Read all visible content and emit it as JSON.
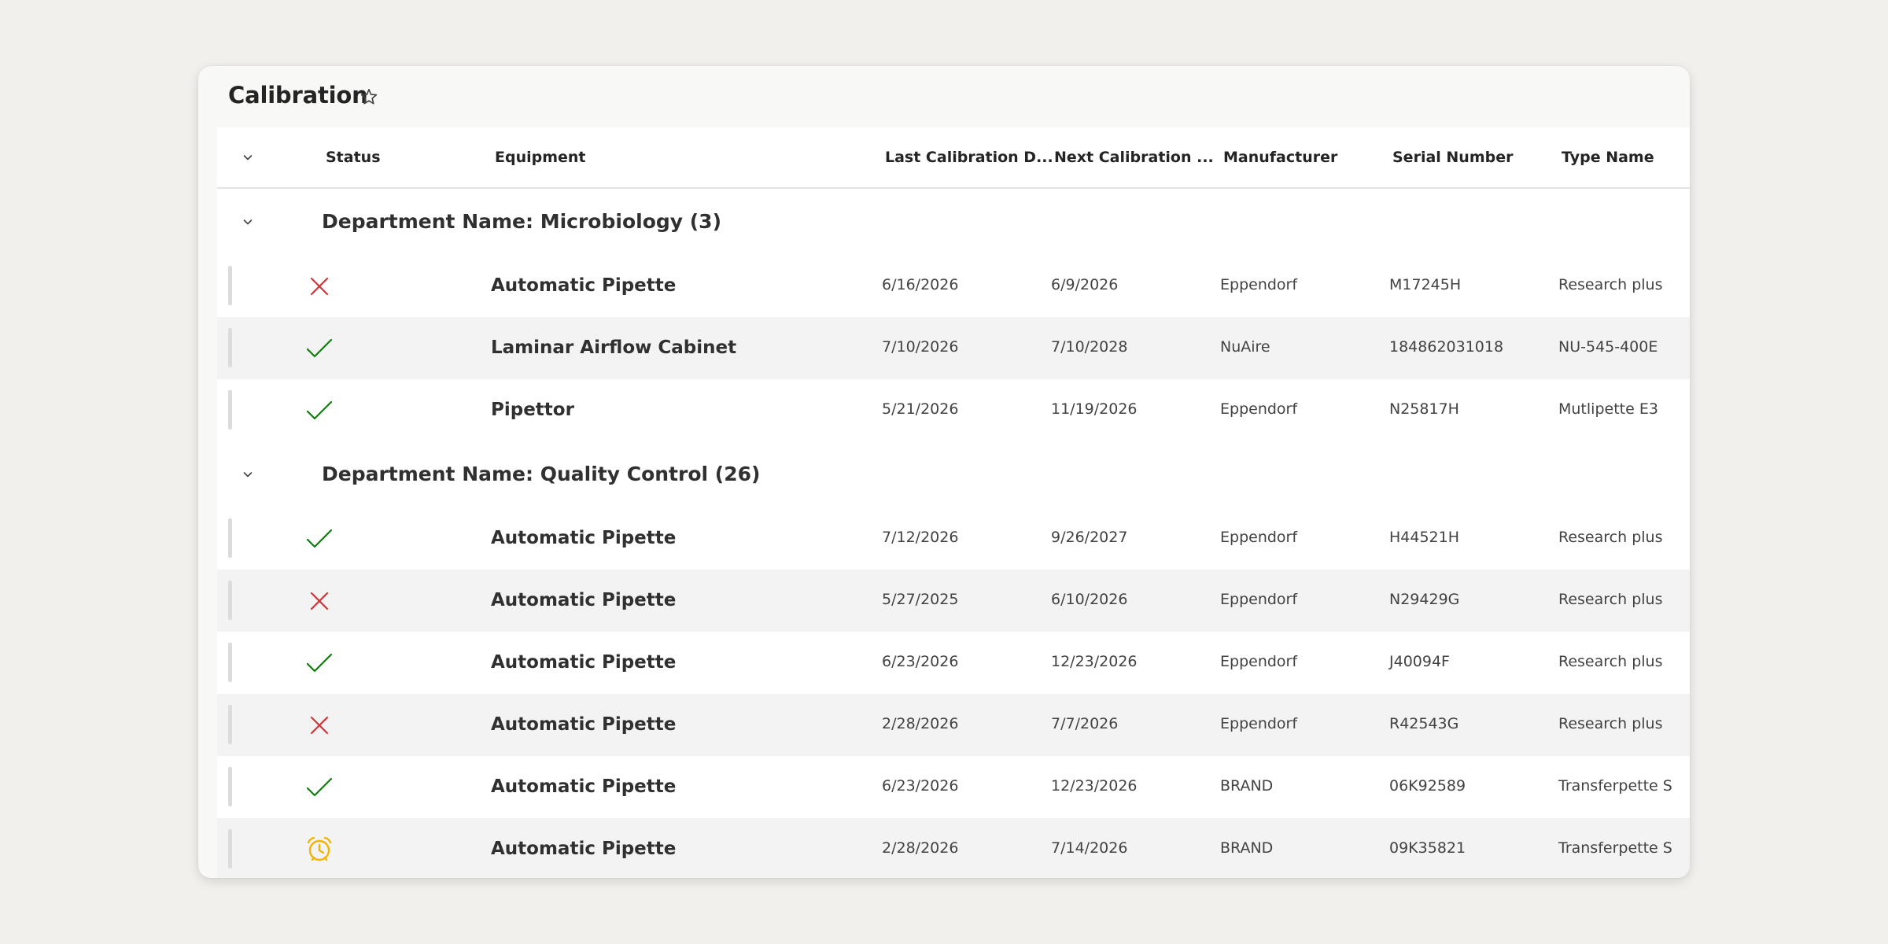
{
  "page": {
    "title": "Calibration",
    "favorite_icon": "star-outline-icon"
  },
  "columns": {
    "status": "Status",
    "equipment": "Equipment",
    "last_calibration": "Last Calibration D...",
    "next_calibration": "Next Calibration ...",
    "manufacturer": "Manufacturer",
    "serial_number": "Serial Number",
    "type_name": "Type Name"
  },
  "status_icons": {
    "fail": {
      "icon": "x-mark-icon",
      "color": "#d13438"
    },
    "pass": {
      "icon": "checkmark-icon",
      "color": "#107c10"
    },
    "due": {
      "icon": "alarm-clock-icon",
      "color": "#f2b400"
    }
  },
  "groups": [
    {
      "label": "Department Name: Microbiology (3)",
      "rows": [
        {
          "status": "fail",
          "equipment": "Automatic Pipette",
          "last": "6/16/2026",
          "next": "6/9/2026",
          "manufacturer": "Eppendorf",
          "serial": "M17245H",
          "type": "Research plus"
        },
        {
          "status": "pass",
          "equipment": "Laminar Airflow Cabinet",
          "last": "7/10/2026",
          "next": "7/10/2028",
          "manufacturer": "NuAire",
          "serial": "184862031018",
          "type": "NU-545-400E"
        },
        {
          "status": "pass",
          "equipment": "Pipettor",
          "last": "5/21/2026",
          "next": "11/19/2026",
          "manufacturer": "Eppendorf",
          "serial": "N25817H",
          "type": "Mutlipette E3"
        }
      ]
    },
    {
      "label": "Department Name: Quality Control (26)",
      "rows": [
        {
          "status": "pass",
          "equipment": "Automatic Pipette",
          "last": "7/12/2026",
          "next": "9/26/2027",
          "manufacturer": "Eppendorf",
          "serial": "H44521H",
          "type": "Research plus"
        },
        {
          "status": "fail",
          "equipment": "Automatic Pipette",
          "last": "5/27/2025",
          "next": "6/10/2026",
          "manufacturer": "Eppendorf",
          "serial": "N29429G",
          "type": "Research plus"
        },
        {
          "status": "pass",
          "equipment": "Automatic Pipette",
          "last": "6/23/2026",
          "next": "12/23/2026",
          "manufacturer": "Eppendorf",
          "serial": "J40094F",
          "type": "Research plus"
        },
        {
          "status": "fail",
          "equipment": "Automatic Pipette",
          "last": "2/28/2026",
          "next": "7/7/2026",
          "manufacturer": "Eppendorf",
          "serial": "R42543G",
          "type": "Research plus"
        },
        {
          "status": "pass",
          "equipment": "Automatic Pipette",
          "last": "6/23/2026",
          "next": "12/23/2026",
          "manufacturer": "BRAND",
          "serial": "06K92589",
          "type": "Transferpette S"
        },
        {
          "status": "due",
          "equipment": "Automatic Pipette",
          "last": "2/28/2026",
          "next": "7/14/2026",
          "manufacturer": "BRAND",
          "serial": "09K35821",
          "type": "Transferpette S"
        }
      ]
    }
  ]
}
